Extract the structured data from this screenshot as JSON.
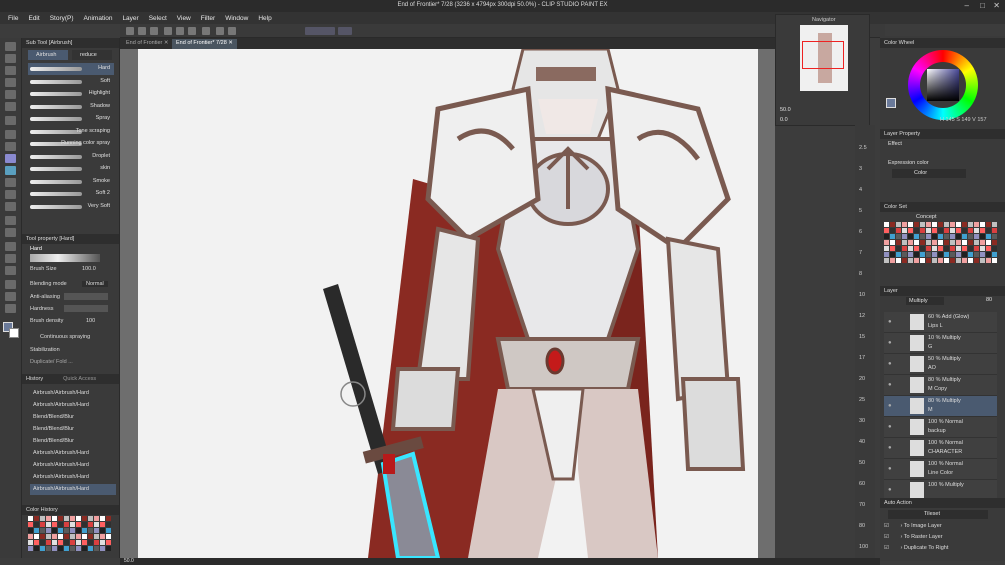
{
  "window": {
    "title": "End of Frontier* 7/28 (3236 x 4794px 300dpi 50.0%)  - CLIP STUDIO PAINT EX"
  },
  "menu": [
    "File",
    "Edit",
    "Story(P)",
    "Animation",
    "Layer",
    "Select",
    "View",
    "Filter",
    "Window",
    "Help"
  ],
  "tabs": [
    {
      "label": "End of Frontier"
    },
    {
      "label": "End of Frontier* 7/28"
    }
  ],
  "subtool": {
    "header": "Sub Tool [Airbrush]",
    "tabs": [
      "Airbrush",
      "reduce"
    ],
    "brushes": [
      "Hard",
      "Soft",
      "Highlight",
      "Shadow",
      "Spray",
      "Tone scraping",
      "Running color spray",
      "Droplet",
      "skin",
      "Smoke",
      "Soft 2",
      "Very Soft"
    ]
  },
  "toolprop": {
    "header": "Tool property [Hard]",
    "name": "Hard",
    "brush_size_label": "Brush Size",
    "brush_size": "100.0",
    "blending_label": "Blending mode",
    "blending": "Normal",
    "antialias_label": "Anti-aliasing",
    "hardness_label": "Hardness",
    "density_label": "Brush density",
    "density": "100",
    "continuous": "Continuous spraying",
    "stabilization_label": "Stabilization",
    "more": "Duplicate/ Fold ..."
  },
  "history": {
    "header": "History",
    "tab2": "Quick Access",
    "items": [
      "Airbrush/Airbrush/Hard",
      "Airbrush/Airbrush/Hard",
      "Blend/Blend/Blur",
      "Blend/Blend/Blur",
      "Blend/Blend/Blur",
      "Airbrush/Airbrush/Hard",
      "Airbrush/Airbrush/Hard",
      "Airbrush/Airbrush/Hard",
      "Airbrush/Airbrush/Hard"
    ]
  },
  "colorhistory": {
    "header": "Color History"
  },
  "navigator": {
    "header": "Navigator",
    "zoom": "50.0",
    "angle": "0.0"
  },
  "ruler": {
    "marks": [
      "2.5",
      "3",
      "4",
      "5",
      "6",
      "7",
      "8",
      "10",
      "12",
      "15",
      "17",
      "20",
      "25",
      "30",
      "40",
      "50",
      "60",
      "70",
      "80",
      "100"
    ]
  },
  "colorwheel": {
    "header": "Color Wheel",
    "h": "145",
    "s": "149",
    "v": "157",
    "accent": "#4a4a9a"
  },
  "layerprop": {
    "header": "Layer Property",
    "effect": "Effect",
    "expression_label": "Expression color",
    "expression": "Color"
  },
  "colorset": {
    "header": "Color Set",
    "name": "Concept"
  },
  "layers": {
    "header": "Layer",
    "blend": "Multiply",
    "opacity": "80",
    "items": [
      {
        "pct": "60 % Add (Glow)",
        "name": "Lips L"
      },
      {
        "pct": "10 % Multiply",
        "name": "G"
      },
      {
        "pct": "50 % Multiply",
        "name": "AO"
      },
      {
        "pct": "80 % Multiply",
        "name": "M Copy"
      },
      {
        "pct": "80 % Multiply",
        "name": "M"
      },
      {
        "pct": "100 % Normal",
        "name": "backup"
      },
      {
        "pct": "100 % Normal",
        "name": "CHARACTER"
      },
      {
        "pct": "100 % Normal",
        "name": "Line Color"
      },
      {
        "pct": "100 % Multiply",
        "name": ""
      }
    ]
  },
  "autoaction": {
    "header": "Auto Action",
    "set": "Tileset",
    "items": [
      "To Image Layer",
      "To Raster Layer",
      "Duplicate To Right"
    ]
  },
  "status": {
    "zoom": "50.0"
  }
}
